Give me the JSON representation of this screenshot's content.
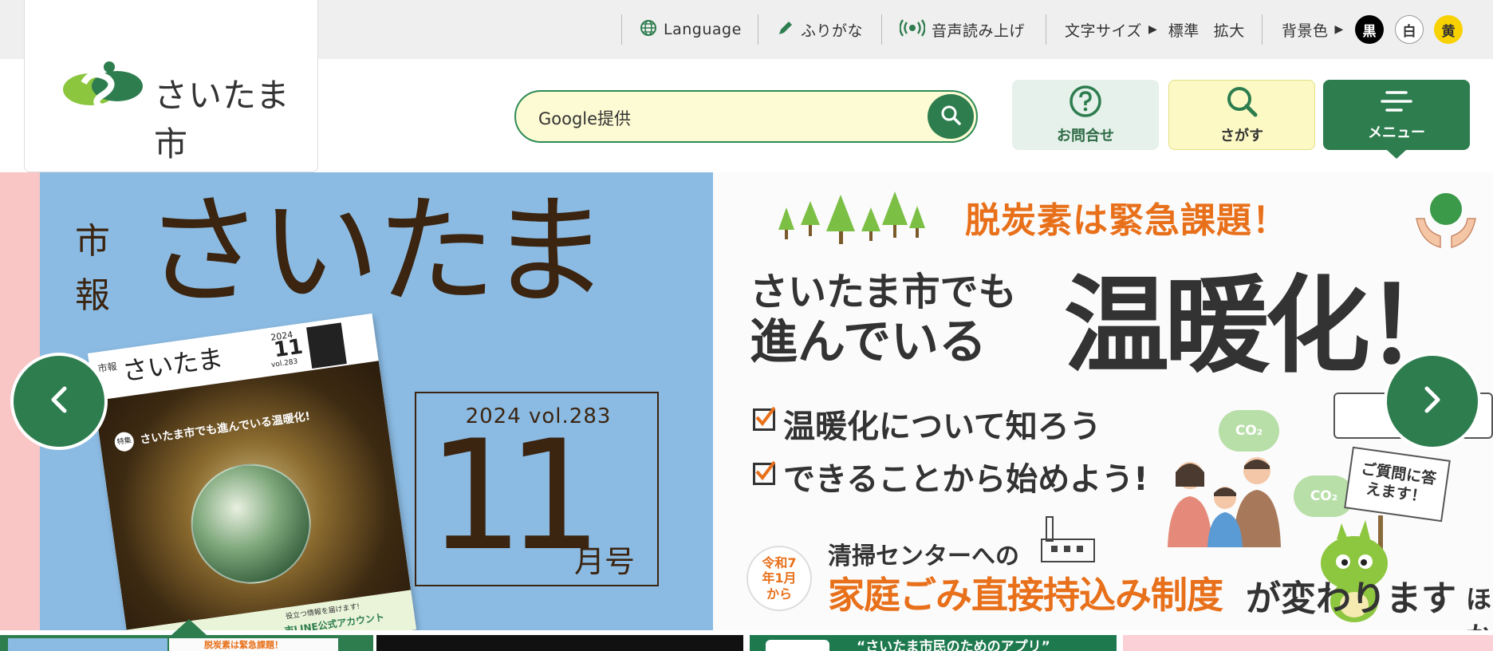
{
  "utility": {
    "language": "Language",
    "furigana": "ふりがな",
    "speech": "音声読み上げ",
    "font_size_label": "文字サイズ",
    "font_standard": "標準",
    "font_large": "拡大",
    "bg_color_label": "背景色",
    "bg_black": "黒",
    "bg_white": "白",
    "bg_yellow": "黄"
  },
  "logo": {
    "text": "さいたま市"
  },
  "search": {
    "placeholder": "Google提供"
  },
  "header_buttons": {
    "contact": "お問合せ",
    "find": "さがす",
    "menu": "メニュー"
  },
  "slide1": {
    "shi": "市",
    "ho": "報",
    "title": "さいたま",
    "year_vol": "2024 vol.283",
    "month_num": "11",
    "month_suffix": "月号",
    "cover_shiho": "市報",
    "cover_title": "さいたま",
    "cover_year": "2024",
    "cover_num": "11",
    "cover_vol": "vol.283",
    "cover_tag": "特集",
    "cover_headline": "さいたま市でも進んでいる温暖化!",
    "cover_line": "市LINE公式アカウント",
    "cover_small": "役立つ情報を届けます!"
  },
  "slide2": {
    "urgent": "脱炭素は緊急課題！",
    "line1": "さいたま市でも",
    "line2": "進んでいる",
    "big": "温暖化！",
    "check1": "温暖化について知ろう",
    "check2": "できることから始めよう!",
    "co2": "CO₂",
    "bubble": "ご質問に答えます！",
    "badge": "令和7年1月から",
    "center": "清掃センターへの",
    "system": "家庭ごみ直接持込み制度",
    "change": "が変わります",
    "hoka": "ほか"
  },
  "thumbnails": {
    "t1": "脱炭素は緊急課題！",
    "t4": "“さいたま市民のためのアプリ”"
  },
  "colors": {
    "brand_green": "#2e7d4f",
    "search_bg": "#fdfbd3",
    "slide_blue": "#8bbbe3",
    "orange": "#e8701a"
  }
}
